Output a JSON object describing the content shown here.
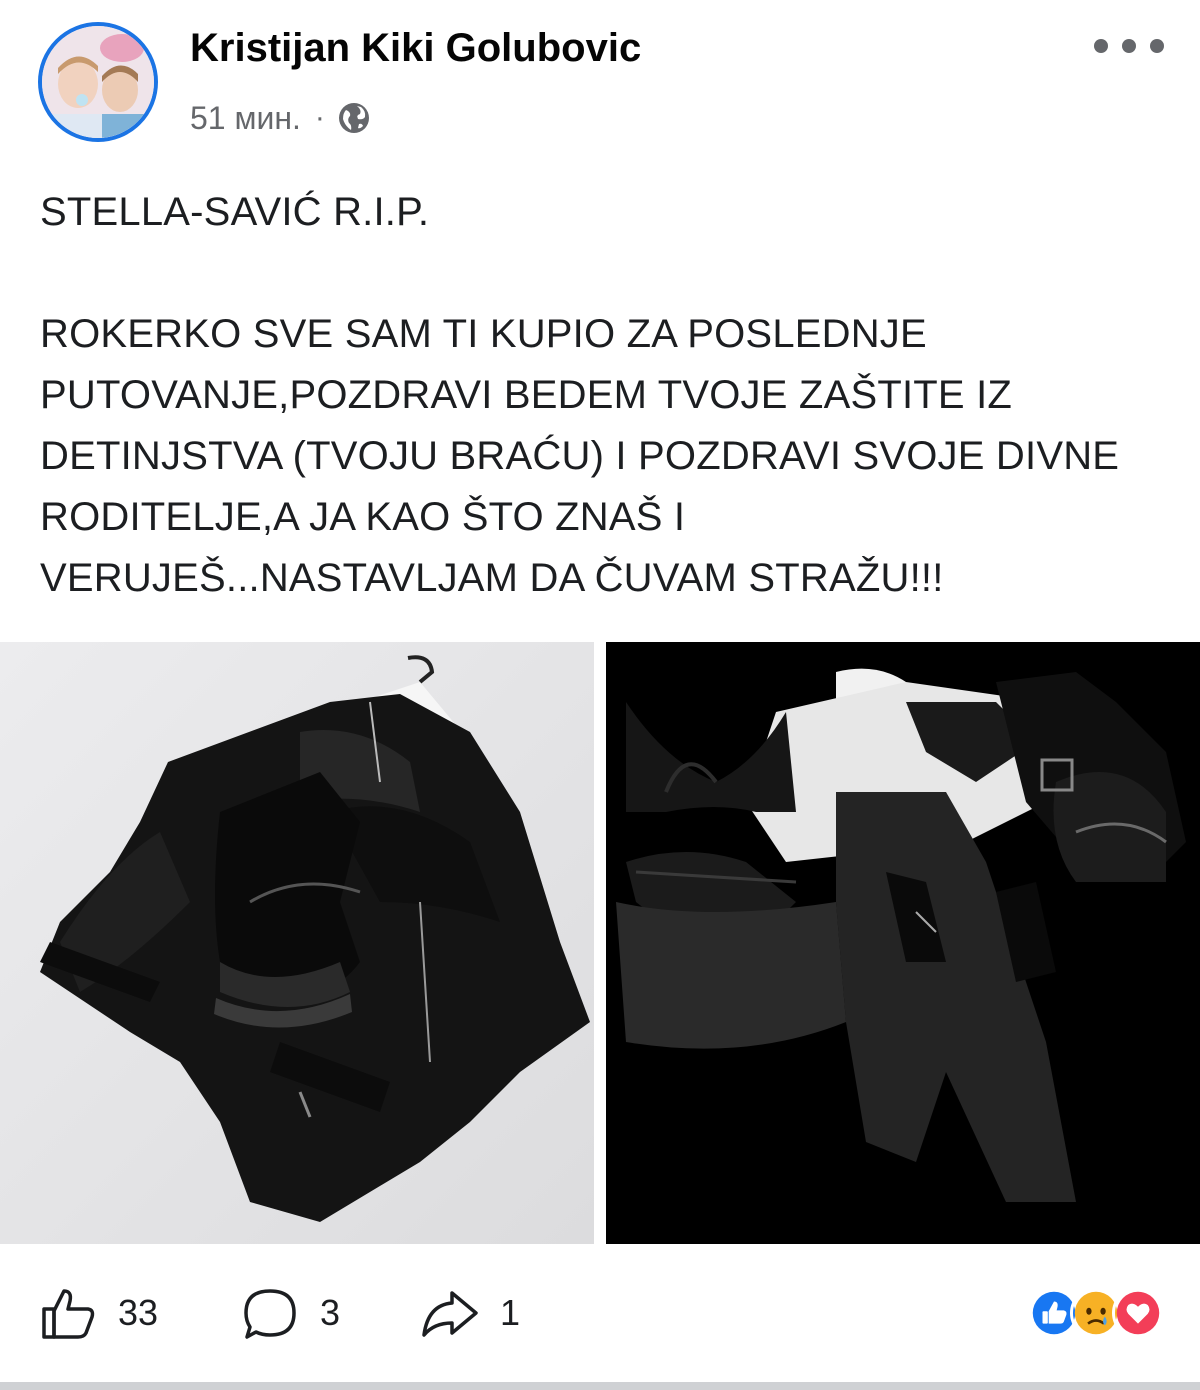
{
  "post": {
    "author": "Kristijan Kiki Golubovic",
    "time": "51 мин.",
    "separator": "·",
    "privacy_icon": "globe-icon",
    "more_icon": "more-dots-icon",
    "text": "STELLA-SAVIĆ R.I.P.\n\nROKERKO SVE SAM TI KUPIO ZA POSLEDNJE PUTOVANJE,POZDRAVI BEDEM TVOJE ZAŠTITE IZ DETINJSTVA (TVOJU BRAĆU) I POZDRAVI SVOJE DIVNE RODITELJE,A JA KAO ŠTO ZNAŠ I VERUJEŠ...NASTAVLJAM DA ČUVAM STRAŽU!!!"
  },
  "actions": {
    "like_count": "33",
    "comment_count": "3",
    "share_count": "1"
  },
  "reactions": [
    "like",
    "sad",
    "love"
  ],
  "colors": {
    "avatar_ring": "#1b74e4",
    "like_blue": "#1877f2",
    "love_red": "#f33e58",
    "sad_yellow": "#f7b125",
    "secondary_text": "#65676b"
  }
}
